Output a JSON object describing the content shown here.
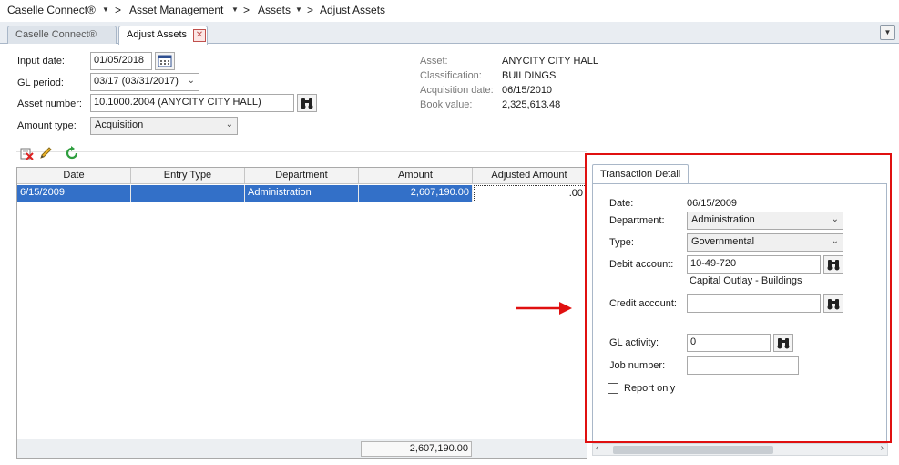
{
  "breadcrumb": {
    "items": [
      "Caselle Connect®",
      "Asset Management",
      "Assets",
      "Adjust Assets"
    ],
    "separator": ">"
  },
  "tabs": {
    "items": [
      "Caselle Connect®",
      "Adjust Assets"
    ],
    "close_glyph": "✕"
  },
  "form": {
    "input_date_label": "Input date:",
    "input_date_value": "01/05/2018",
    "gl_period_label": "GL period:",
    "gl_period_value": "03/17 (03/31/2017)",
    "asset_number_label": "Asset number:",
    "asset_number_value": "10.1000.2004 (ANYCITY CITY HALL)",
    "amount_type_label": "Amount type:",
    "amount_type_value": "Acquisition"
  },
  "asset_info": {
    "asset_label": "Asset:",
    "asset_value": "ANYCITY CITY HALL",
    "classification_label": "Classification:",
    "classification_value": "BUILDINGS",
    "acq_date_label": "Acquisition date:",
    "acq_date_value": "06/15/2010",
    "book_value_label": "Book value:",
    "book_value_value": "2,325,613.48"
  },
  "grid": {
    "columns": [
      "Date",
      "Entry Type",
      "Department",
      "Amount",
      "Adjusted Amount"
    ],
    "row": {
      "date": "6/15/2009",
      "entry_type": "",
      "department": "Administration",
      "amount": "2,607,190.00",
      "adjusted_amount": ".00"
    },
    "total": "2,607,190.00"
  },
  "detail": {
    "tab_label": "Transaction Detail",
    "date_label": "Date:",
    "date_value": "06/15/2009",
    "department_label": "Department:",
    "department_value": "Administration",
    "type_label": "Type:",
    "type_value": "Governmental",
    "debit_label": "Debit account:",
    "debit_value": "10-49-720",
    "debit_desc": "Capital Outlay - Buildings",
    "credit_label": "Credit account:",
    "credit_value": "",
    "gl_activity_label": "GL activity:",
    "gl_activity_value": "0",
    "job_number_label": "Job number:",
    "job_number_value": "",
    "report_only_label": "Report only"
  },
  "colors": {
    "selection": "#3370c8",
    "highlight": "#e01010",
    "tab_bg": "#e9edf2"
  }
}
